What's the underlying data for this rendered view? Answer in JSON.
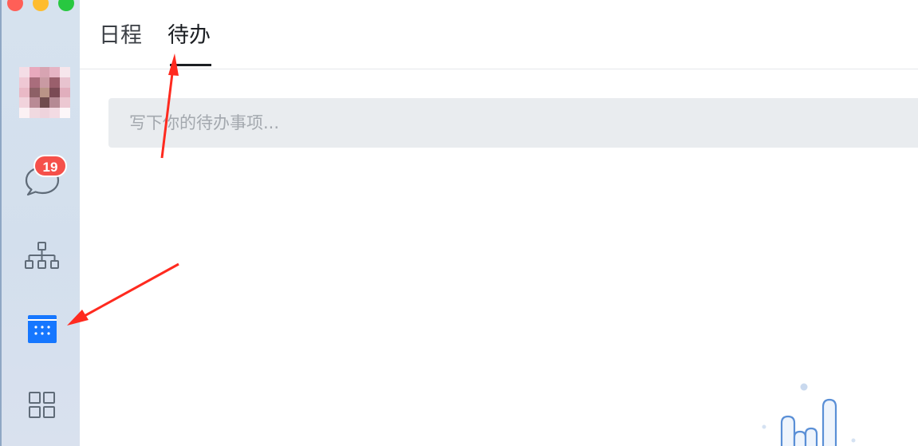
{
  "window": {
    "controls": [
      "close",
      "minimize",
      "maximize"
    ]
  },
  "sidebar": {
    "avatar_icon": "user-avatar (pixelated)",
    "items": [
      {
        "id": "chat",
        "icon": "chat-bubble-icon",
        "badge": "19"
      },
      {
        "id": "org",
        "icon": "org-chart-icon"
      },
      {
        "id": "calendar",
        "icon": "calendar-icon",
        "active": true
      },
      {
        "id": "apps",
        "icon": "grid-apps-icon"
      }
    ]
  },
  "tabs": [
    {
      "label": "日程"
    },
    {
      "label": "待办",
      "active": true
    }
  ],
  "todo": {
    "placeholder": "写下你的待办事项..."
  },
  "colors": {
    "accent": "#1677ff",
    "badge": "#f5504a",
    "annotation_arrow": "#ff2a1f"
  }
}
